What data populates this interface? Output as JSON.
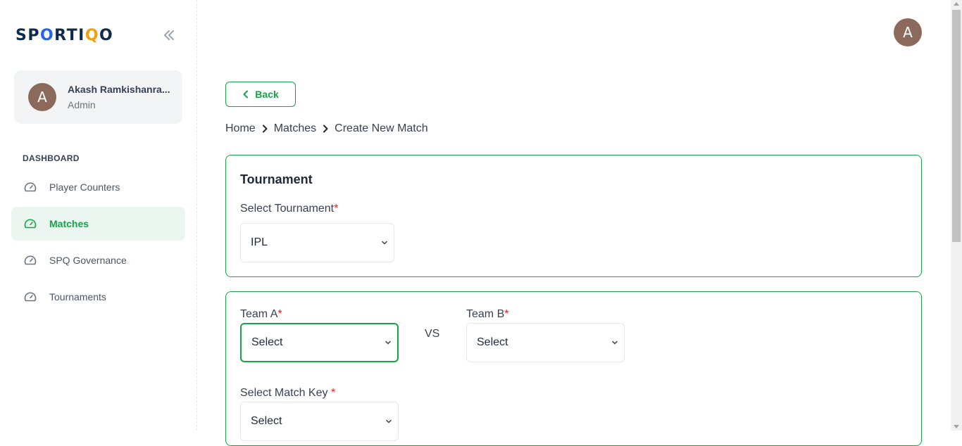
{
  "brand": {
    "logo_text_1": "SP",
    "logo_text_o": "O",
    "logo_text_2": "RTI",
    "logo_text_q": "Q",
    "logo_text_3": "O"
  },
  "sidebar": {
    "user": {
      "initial": "A",
      "name": "Akash Ramkishanra...",
      "role": "Admin"
    },
    "section_label": "DASHBOARD",
    "items": [
      {
        "label": "Player Counters",
        "icon": "gauge-icon",
        "active": false
      },
      {
        "label": "Matches",
        "icon": "gauge-icon",
        "active": true
      },
      {
        "label": "SPQ Governance",
        "icon": "gauge-icon",
        "active": false
      },
      {
        "label": "Tournaments",
        "icon": "gauge-icon",
        "active": false
      }
    ]
  },
  "header": {
    "avatar_initial": "A"
  },
  "back_button": {
    "label": "Back"
  },
  "breadcrumb": [
    "Home",
    "Matches",
    "Create New Match"
  ],
  "tournament_card": {
    "title": "Tournament",
    "select_label": "Select Tournament",
    "required_mark": "*",
    "selected_value": "IPL"
  },
  "match_card": {
    "team_a_label": "Team A",
    "team_a_value": "Select",
    "vs_text": "VS",
    "team_b_label": "Team B",
    "team_b_value": "Select",
    "match_key_label": "Select Match Key ",
    "match_key_value": "Select",
    "required_mark": "*"
  },
  "colors": {
    "accent": "#16a34a",
    "active_bg": "#eaf6ef",
    "required": "#dc2626",
    "avatar": "#8b6a5c"
  }
}
